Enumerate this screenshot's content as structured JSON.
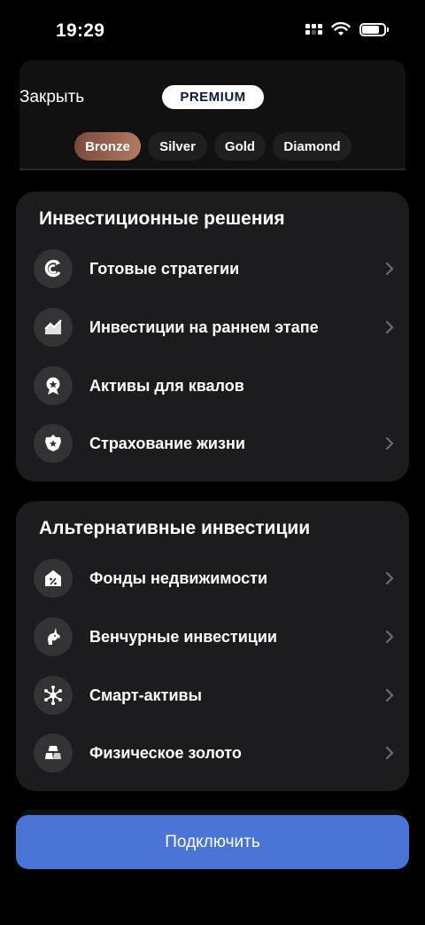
{
  "status_bar": {
    "time": "19:29"
  },
  "header": {
    "close_label": "Закрыть",
    "badge": "PREMIUM",
    "tiers": [
      {
        "label": "Bronze",
        "active": true
      },
      {
        "label": "Silver",
        "active": false
      },
      {
        "label": "Gold",
        "active": false
      },
      {
        "label": "Diamond",
        "active": false
      }
    ]
  },
  "sections": [
    {
      "title": "Инвестиционные решения",
      "items": [
        {
          "label": "Готовые стратегии",
          "icon": "strategy-icon",
          "chevron": true
        },
        {
          "label": "Инвестиции на раннем этапе",
          "icon": "growth-chart-icon",
          "chevron": true
        },
        {
          "label": "Активы для квалов",
          "icon": "award-badge-icon",
          "chevron": false
        },
        {
          "label": "Страхование жизни",
          "icon": "shield-star-icon",
          "chevron": true
        }
      ]
    },
    {
      "title": "Альтернативные инвестиции",
      "items": [
        {
          "label": "Фонды недвижимости",
          "icon": "house-percent-icon",
          "chevron": true
        },
        {
          "label": "Венчурные инвестиции",
          "icon": "unicorn-icon",
          "chevron": true
        },
        {
          "label": "Смарт-активы",
          "icon": "network-nodes-icon",
          "chevron": true
        },
        {
          "label": "Физическое золото",
          "icon": "gold-bars-icon",
          "chevron": true
        }
      ]
    }
  ],
  "footer": {
    "button_label": "Подключить"
  },
  "colors": {
    "accent": "#4a73d6",
    "card": "#1c1c1e",
    "bronze": "#a06a55"
  }
}
